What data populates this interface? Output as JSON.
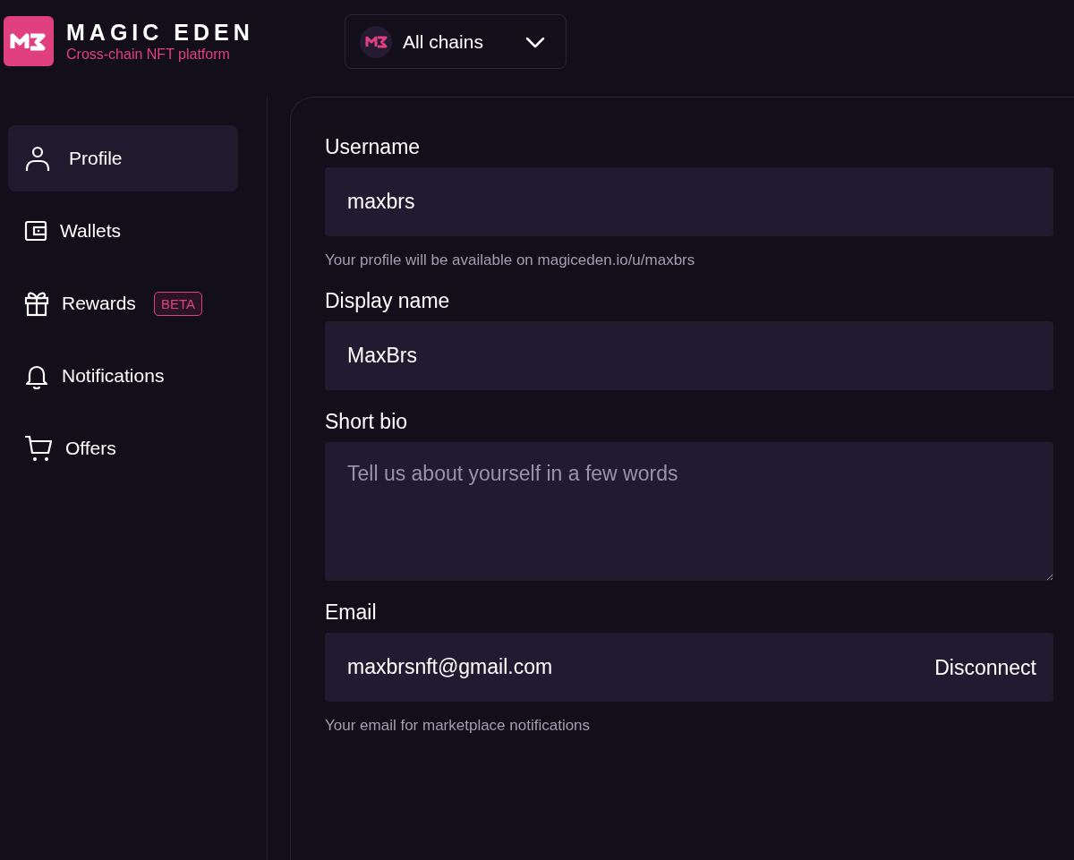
{
  "brand": {
    "name": "MAGIC EDEN",
    "tagline": "Cross-chain NFT platform"
  },
  "chain_selector": {
    "label": "All chains"
  },
  "sidebar": {
    "items": [
      {
        "label": "Profile",
        "selected": true
      },
      {
        "label": "Wallets",
        "selected": false
      },
      {
        "label": "Rewards",
        "selected": false,
        "badge": "BETA"
      },
      {
        "label": "Notifications",
        "selected": false
      },
      {
        "label": "Offers",
        "selected": false
      }
    ]
  },
  "form": {
    "fields": [
      {
        "kind": "input",
        "label": "Username",
        "value": "maxbrs",
        "helper": "Your profile will be available on magiceden.io/u/maxbrs"
      },
      {
        "kind": "input",
        "label": "Display name",
        "value": "MaxBrs"
      },
      {
        "kind": "textarea",
        "label": "Short bio",
        "placeholder": "Tell us about yourself in a few words"
      },
      {
        "kind": "input",
        "label": "Email",
        "value": "maxbrsnft@gmail.com",
        "action": "Disconnect",
        "helper": "Your email for marketplace notifications"
      }
    ]
  }
}
